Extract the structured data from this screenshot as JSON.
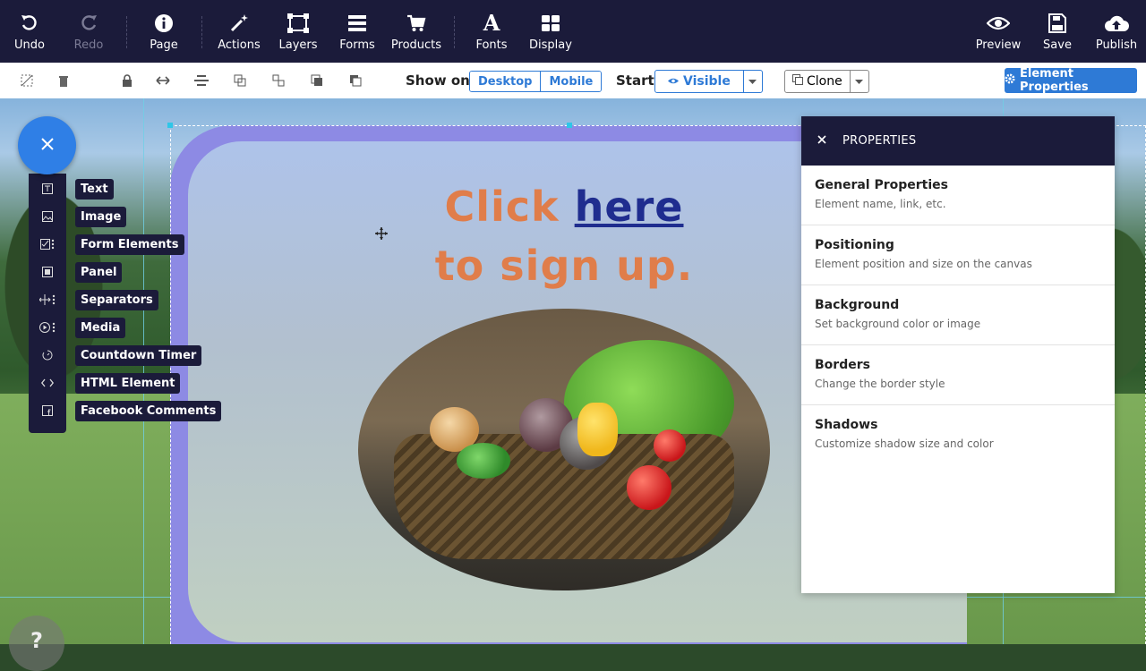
{
  "toolbar": {
    "undo": "Undo",
    "redo": "Redo",
    "page": "Page",
    "actions": "Actions",
    "layers": "Layers",
    "forms": "Forms",
    "products": "Products",
    "fonts": "Fonts",
    "display": "Display",
    "preview": "Preview",
    "save": "Save",
    "publish": "Publish"
  },
  "subbar": {
    "show_on": "Show on",
    "desktop": "Desktop",
    "mobile": "Mobile",
    "start": "Start",
    "visible": "Visible",
    "clone": "Clone",
    "element_properties": "Element Properties"
  },
  "canvas": {
    "headline_part1": "Click",
    "headline_link": "here",
    "headline_part2": "to sign up.",
    "colors": {
      "panel": "#8d8ae4",
      "headline": "#e07d4a",
      "link": "#1f2d8f"
    }
  },
  "add_menu": {
    "items": [
      {
        "label": "Text",
        "icon": "text-icon"
      },
      {
        "label": "Image",
        "icon": "image-icon"
      },
      {
        "label": "Form Elements",
        "icon": "form-elements-icon"
      },
      {
        "label": "Panel",
        "icon": "panel-icon"
      },
      {
        "label": "Separators",
        "icon": "separators-icon"
      },
      {
        "label": "Media",
        "icon": "media-icon"
      },
      {
        "label": "Countdown Timer",
        "icon": "countdown-timer-icon"
      },
      {
        "label": "HTML Element",
        "icon": "html-element-icon"
      },
      {
        "label": "Facebook Comments",
        "icon": "facebook-comments-icon"
      }
    ]
  },
  "properties": {
    "title": "PROPERTIES",
    "sections": [
      {
        "title": "General Properties",
        "desc": "Element name, link, etc."
      },
      {
        "title": "Positioning",
        "desc": "Element position and size on the canvas"
      },
      {
        "title": "Background",
        "desc": "Set background color or image"
      },
      {
        "title": "Borders",
        "desc": "Change the border style"
      },
      {
        "title": "Shadows",
        "desc": "Customize shadow size and color"
      }
    ]
  },
  "help": {
    "label": "?"
  }
}
